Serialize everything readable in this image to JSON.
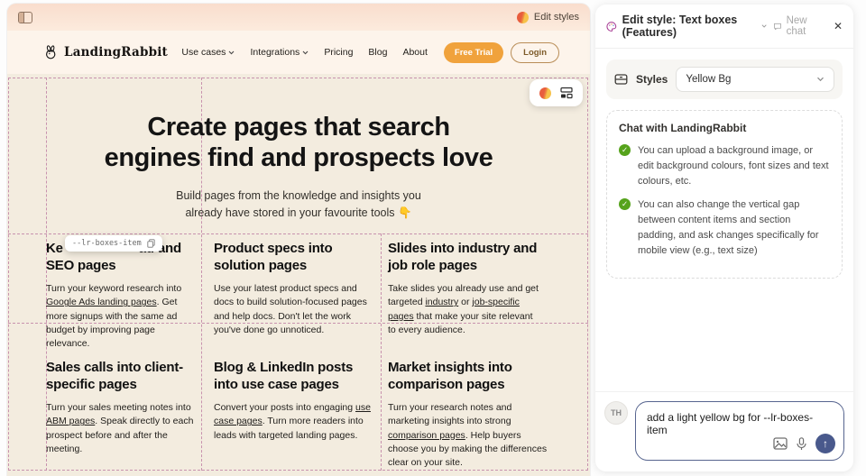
{
  "chrome": {
    "edit_styles_label": "Edit styles"
  },
  "preview": {
    "nav": {
      "brand": "LandingRabbit",
      "items": [
        "Use cases",
        "Integrations",
        "Pricing",
        "Blog",
        "About"
      ],
      "cta_primary": "Free Trial",
      "cta_secondary": "Login"
    },
    "hero": {
      "title_line1": "Create pages that search",
      "title_line2": "engines find and prospects love",
      "subtitle_line1": "Build pages from the knowledge and insights you",
      "subtitle_line2": "already have stored in your favourite tools 👇"
    },
    "tooltip": {
      "text": "--lr-boxes-item"
    },
    "cards": [
      {
        "title_pre": "Ke",
        "title_mid": "ad and",
        "title_line2": "SEO pages",
        "body": [
          {
            "t": "Turn your keyword research into "
          },
          {
            "t": "Google Ads landing pages",
            "link": true
          },
          {
            "t": ". Get more signups with the same ad budget by improving page relevance."
          }
        ]
      },
      {
        "title": "Product specs into solution pages",
        "body": [
          {
            "t": "Use your latest product specs and docs to build solution-focused pages and help docs. Don't let the work you've done go unnoticed."
          }
        ]
      },
      {
        "title": "Slides into industry and job role pages",
        "body": [
          {
            "t": "Take slides you already use and get targeted "
          },
          {
            "t": "industry",
            "link": true
          },
          {
            "t": " or "
          },
          {
            "t": "job-specific pages",
            "link": true
          },
          {
            "t": " that make your site relevant to every audience."
          }
        ]
      },
      {
        "title": "Sales calls into client-specific pages",
        "body": [
          {
            "t": "Turn your sales meeting notes into "
          },
          {
            "t": "ABM pages",
            "link": true
          },
          {
            "t": ". Speak directly to each prospect before and after the meeting."
          }
        ]
      },
      {
        "title": "Blog & LinkedIn posts into use case pages",
        "body": [
          {
            "t": "Convert your posts into engaging "
          },
          {
            "t": "use case pages",
            "link": true
          },
          {
            "t": ". Turn more readers into leads with targeted landing pages."
          }
        ]
      },
      {
        "title": "Market insights into comparison pages",
        "body": [
          {
            "t": "Turn your research notes and marketing insights into strong "
          },
          {
            "t": "comparison pages",
            "link": true
          },
          {
            "t": ". Help buyers choose you by making the differences clear on your site."
          }
        ]
      }
    ]
  },
  "panel": {
    "title": "Edit style: Text boxes (Features)",
    "new_chat_label": "New chat",
    "close_glyph": "✕",
    "styles_label": "Styles",
    "styles_value": "Yellow Bg",
    "chat_title": "Chat with LandingRabbit",
    "bullets": [
      "You can upload a background image, or edit background colours, font sizes and text colours, etc.",
      "You can also change the vertical gap between content items and section padding, and ask changes specifically for mobile view (e.g., text size)"
    ],
    "avatar_initials": "TH",
    "input_value": "add a light yellow bg for --lr-boxes-item",
    "send_glyph": "↑"
  },
  "colors": {
    "accent_orange": "#f0a23c",
    "gradient_red": "#e85d3d",
    "gradient_yellow": "#f6c24a",
    "check_green": "#56a31c",
    "send_navy": "#49598c",
    "palette_magenta": "#a63a92",
    "guide_dash_pink": "#c892ae",
    "page_cream": "#f3ecdf",
    "navbar_cream": "#fdf4eb",
    "chrome_peach": "#f9ddcd"
  }
}
